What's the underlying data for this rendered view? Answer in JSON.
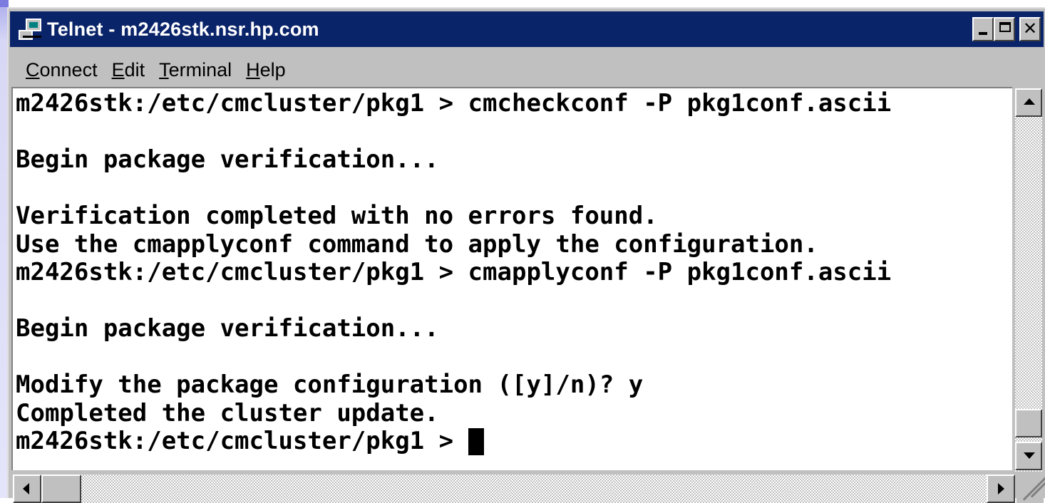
{
  "window": {
    "title": "Telnet - m2426stk.nsr.hp.com",
    "icon": "telnet-computer-icon",
    "controls": [
      "minimize",
      "maximize",
      "close"
    ]
  },
  "menu": [
    {
      "accel": "C",
      "rest": "onnect"
    },
    {
      "accel": "E",
      "rest": "dit"
    },
    {
      "accel": "T",
      "rest": "erminal"
    },
    {
      "accel": "H",
      "rest": "elp"
    }
  ],
  "terminal": {
    "lines": [
      "m2426stk:/etc/cmcluster/pkg1 > cmcheckconf -P pkg1conf.ascii",
      "",
      "Begin package verification...",
      "",
      "Verification completed with no errors found.",
      "Use the cmapplyconf command to apply the configuration.",
      "m2426stk:/etc/cmcluster/pkg1 > cmapplyconf -P pkg1conf.ascii",
      "",
      "Begin package verification...",
      "",
      "Modify the package configuration ([y]/n)? y",
      "Completed the cluster update."
    ],
    "prompt": "m2426stk:/etc/cmcluster/pkg1 > "
  },
  "colors": {
    "titlebar": "#0a246a",
    "chrome": "#c0c0c0",
    "terminal_bg": "#ffffff",
    "terminal_fg": "#000000"
  }
}
